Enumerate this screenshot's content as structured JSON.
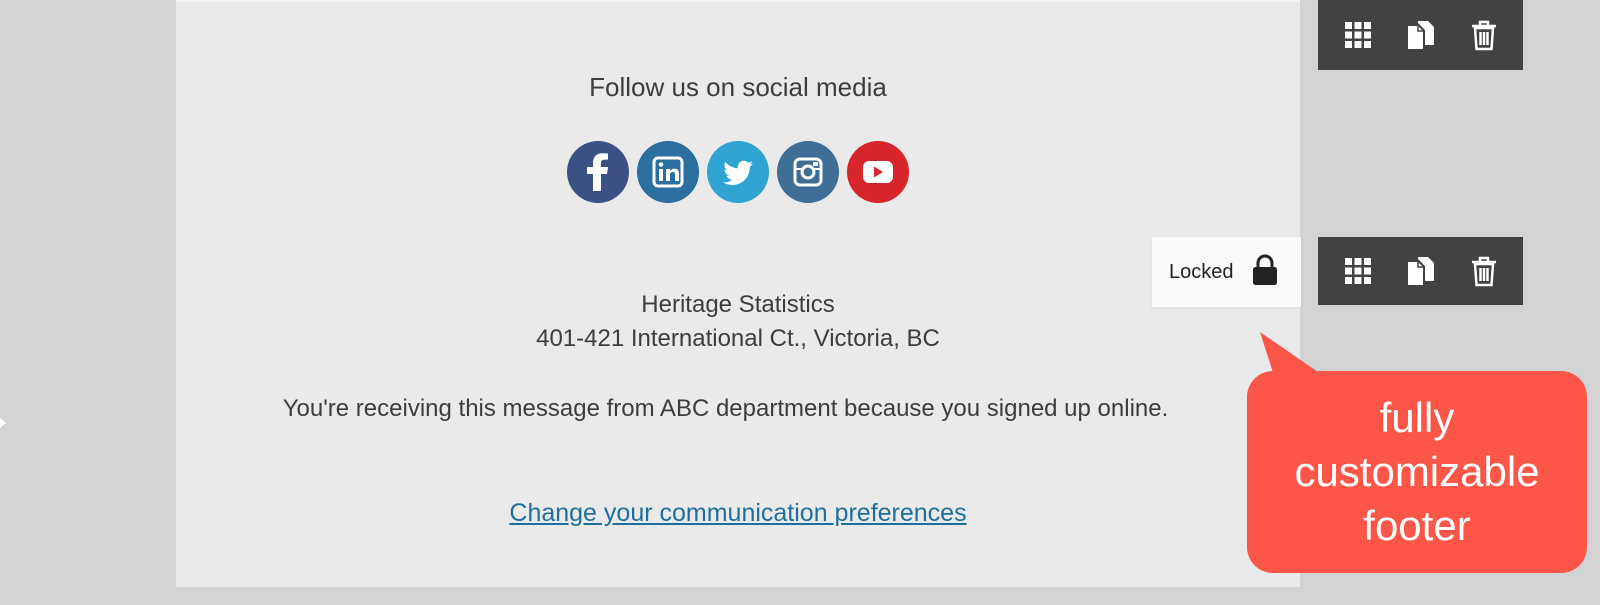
{
  "footer": {
    "follow_title": "Follow us on social media",
    "social_icons": [
      {
        "name": "facebook-icon",
        "glyph": "f",
        "color": "#3b5186"
      },
      {
        "name": "linkedin-icon",
        "glyph": "in",
        "color": "#2b6ea0"
      },
      {
        "name": "twitter-icon",
        "glyph": "bird",
        "color": "#2fa4d0"
      },
      {
        "name": "instagram-icon",
        "glyph": "camera",
        "color": "#3e6e96"
      },
      {
        "name": "youtube-icon",
        "glyph": "play",
        "color": "#d7262b"
      }
    ],
    "org_name": "Heritage Statistics",
    "org_address": "401-421 International Ct., Victoria, BC",
    "disclaimer": "You're receiving this message from ABC department because you signed up online.",
    "prefs_link": "Change your communication preferences"
  },
  "block_controls": {
    "locked_label": "Locked",
    "toolbar_icons": [
      "grid-icon",
      "duplicate-icon",
      "trash-icon"
    ],
    "toolbar_color": "#424242"
  },
  "callout": {
    "text": "fully\ncustomizable\nfooter",
    "color": "#fb5648"
  },
  "colors": {
    "canvas_bg": "#eaeaea",
    "page_bg": "#d3d3d3",
    "link": "#1f6f9e"
  }
}
